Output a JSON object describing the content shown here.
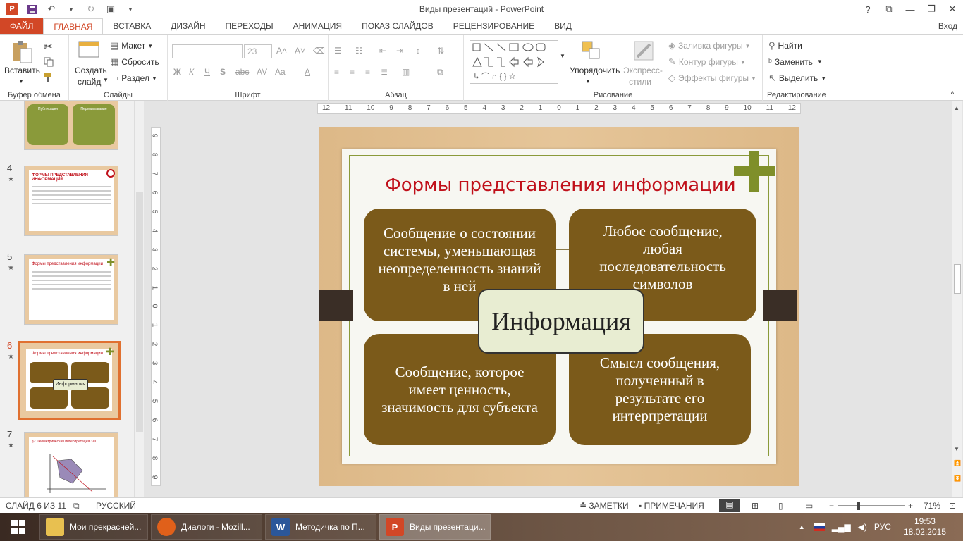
{
  "window": {
    "title": "Виды презентаций - PowerPoint",
    "controls": {
      "help": "?",
      "options": "⧉",
      "minimize": "—",
      "restore": "❐",
      "close": "✕"
    }
  },
  "tabs": {
    "file": "ФАЙЛ",
    "items": [
      "ГЛАВНАЯ",
      "ВСТАВКА",
      "ДИЗАЙН",
      "ПЕРЕХОДЫ",
      "АНИМАЦИЯ",
      "ПОКАЗ СЛАЙДОВ",
      "РЕЦЕНЗИРОВАНИЕ",
      "ВИД"
    ],
    "active": "ГЛАВНАЯ",
    "signin": "Вход"
  },
  "ribbon": {
    "clipboard": {
      "label": "Буфер обмена",
      "paste": "Вставить"
    },
    "slides": {
      "label": "Слайды",
      "new_slide_1": "Создать",
      "new_slide_2": "слайд",
      "layout": "Макет",
      "reset": "Сбросить",
      "section": "Раздел"
    },
    "font": {
      "label": "Шрифт",
      "size": "23",
      "bold": "Ж",
      "italic": "К",
      "underline": "Ч",
      "strike": "S",
      "spacing": "AV",
      "case": "Aa"
    },
    "paragraph": {
      "label": "Абзац"
    },
    "drawing": {
      "label": "Рисование",
      "arrange": "Упорядочить",
      "quick_styles_1": "Экспресс-",
      "quick_styles_2": "стили",
      "fill": "Заливка фигуры",
      "outline": "Контур фигуры",
      "effects": "Эффекты фигуры"
    },
    "editing": {
      "label": "Редактирование",
      "find": "Найти",
      "replace": "Заменить",
      "select": "Выделить"
    }
  },
  "thumbnails": [
    {
      "num": "4",
      "title": "ФОРМЫ ПРЕДСТАВЛЕНИЯ ИНФОРМАЦИИ"
    },
    {
      "num": "5",
      "title": "Формы представления информации"
    },
    {
      "num": "6",
      "title": "Формы представления информации",
      "center": "Информация"
    },
    {
      "num": "7",
      "title": "§2. Геометрическая интерпретация ЗЛП"
    }
  ],
  "thumb_top": {
    "left_title": "Публикация",
    "right_title": "Переписывание"
  },
  "ruler": {
    "h_ticks": [
      "12",
      "11",
      "10",
      "9",
      "8",
      "7",
      "6",
      "5",
      "4",
      "3",
      "2",
      "1",
      "0",
      "1",
      "2",
      "3",
      "4",
      "5",
      "6",
      "7",
      "8",
      "9",
      "10",
      "11",
      "12"
    ],
    "v_ticks": [
      "9",
      "8",
      "7",
      "6",
      "5",
      "4",
      "3",
      "2",
      "1",
      "0",
      "1",
      "2",
      "3",
      "4",
      "5",
      "6",
      "7",
      "8",
      "9"
    ]
  },
  "slide": {
    "title": "Формы представления информации",
    "center": "Информация",
    "top_left": "Сообщение о состоянии системы, уменьшающая неопределенность знаний в ней",
    "top_right": "Любое сообщение, любая последовательность символов",
    "bottom_left": "Сообщение, которое имеет ценность, значимость для субъекта",
    "bottom_right": "Смысл сообщения, полученный в результате его интерпретации",
    "colors": {
      "title": "#c0101a",
      "box": "#7b5a1a",
      "accent": "#7f8f2a",
      "center_fill": "#e8edd2"
    }
  },
  "status": {
    "slide": "СЛАЙД 6 ИЗ 11",
    "language": "РУССКИЙ",
    "notes": "ЗАМЕТКИ",
    "comments": "ПРИМЕЧАНИЯ",
    "zoom": "71%"
  },
  "taskbar": {
    "items": [
      "Мои прекрасней...",
      "Диалоги - Mozill...",
      "Методичка по П...",
      "Виды презентаци..."
    ],
    "lang": "РУС",
    "time": "19:53",
    "date": "18.02.2015"
  }
}
